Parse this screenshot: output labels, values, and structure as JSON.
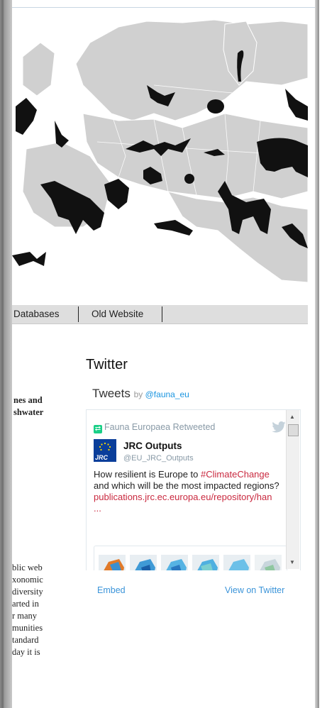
{
  "nav": {
    "items": [
      "Databases",
      "Old Website"
    ]
  },
  "left_text": {
    "heading_lines": [
      "nes and",
      "shwater"
    ],
    "paragraph_lines": [
      "blic web",
      "xonomic",
      "diversity",
      "arted in",
      "r many",
      "munities",
      "tandard",
      "day it is"
    ]
  },
  "twitter": {
    "heading": "Twitter",
    "timeline_title": "Tweets",
    "by_label": "by",
    "by_handle": "@fauna_eu",
    "retweet_label": "Fauna Europaea Retweeted",
    "author_name": "JRC Outputs",
    "author_handle": "@EU_JRC_Outputs",
    "avatar_text": "JRC",
    "tweet_text_1": "How resilient is Europe to",
    "hashtag": "#ClimateChange",
    "tweet_text_2": " and which will be the most impacted regions?",
    "link": "publications.jrc.ec.europa.eu/repository/han",
    "ellipsis": "...",
    "embed_label": "Embed",
    "view_label": "View on Twitter"
  },
  "colors": {
    "link_blue": "#1b95e0",
    "hashtag_red": "#c9293f",
    "retweet_green": "#19cf86",
    "map_grey": "#d0d0d0"
  },
  "icons": {
    "retweet": "retweet-icon",
    "bird": "twitter-bird-icon",
    "up": "scroll-up-icon",
    "down": "scroll-down-icon"
  }
}
